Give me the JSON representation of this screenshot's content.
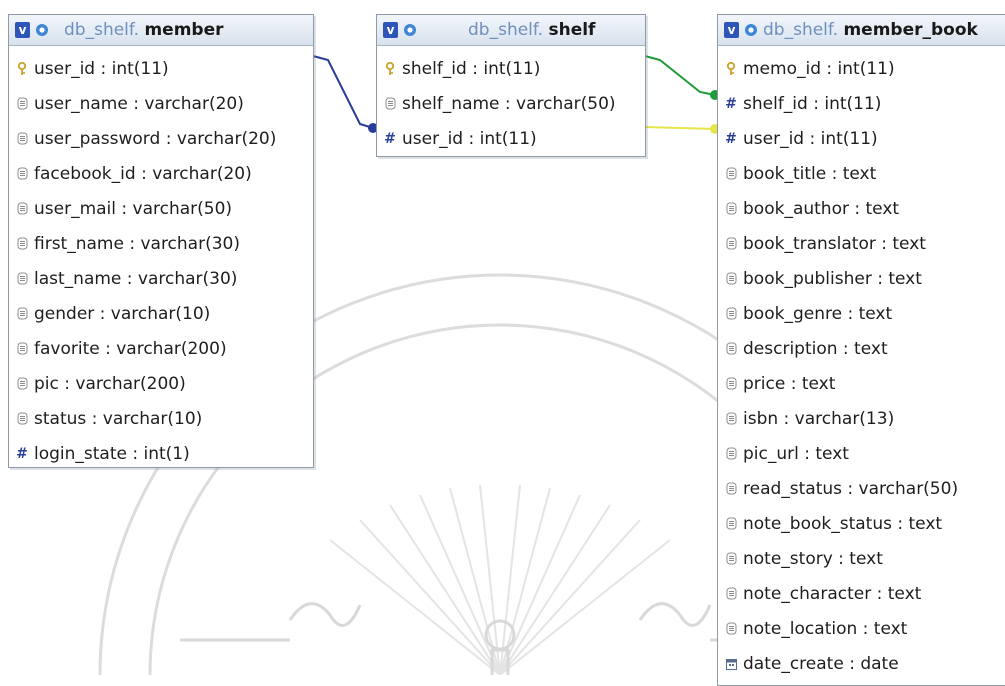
{
  "tables": {
    "member": {
      "schema": "db_shelf.",
      "name": "member",
      "columns": [
        {
          "label": "user_id : int(11)",
          "icon": "primary-key-icon"
        },
        {
          "label": "user_name : varchar(20)",
          "icon": "field-icon"
        },
        {
          "label": "user_password : varchar(20)",
          "icon": "field-icon"
        },
        {
          "label": "facebook_id : varchar(20)",
          "icon": "field-icon"
        },
        {
          "label": "user_mail : varchar(50)",
          "icon": "field-icon"
        },
        {
          "label": "first_name : varchar(30)",
          "icon": "field-icon"
        },
        {
          "label": "last_name : varchar(30)",
          "icon": "field-icon"
        },
        {
          "label": "gender : varchar(10)",
          "icon": "field-icon"
        },
        {
          "label": "favorite : varchar(200)",
          "icon": "field-icon"
        },
        {
          "label": "pic : varchar(200)",
          "icon": "field-icon"
        },
        {
          "label": "status : varchar(10)",
          "icon": "field-icon"
        },
        {
          "label": "login_state : int(1)",
          "icon": "numeric-field-icon"
        }
      ]
    },
    "shelf": {
      "schema": "db_shelf.",
      "name": "shelf",
      "columns": [
        {
          "label": "shelf_id : int(11)",
          "icon": "primary-key-icon"
        },
        {
          "label": "shelf_name : varchar(50)",
          "icon": "field-icon"
        },
        {
          "label": "user_id : int(11)",
          "icon": "numeric-field-icon"
        }
      ]
    },
    "member_book": {
      "schema": "db_shelf.",
      "name": "member_book",
      "columns": [
        {
          "label": "memo_id : int(11)",
          "icon": "primary-key-icon"
        },
        {
          "label": "shelf_id : int(11)",
          "icon": "numeric-field-icon"
        },
        {
          "label": "user_id : int(11)",
          "icon": "numeric-field-icon"
        },
        {
          "label": "book_title : text",
          "icon": "field-icon"
        },
        {
          "label": "book_author : text",
          "icon": "field-icon"
        },
        {
          "label": "book_translator : text",
          "icon": "field-icon"
        },
        {
          "label": "book_publisher : text",
          "icon": "field-icon"
        },
        {
          "label": "book_genre : text",
          "icon": "field-icon"
        },
        {
          "label": "description : text",
          "icon": "field-icon"
        },
        {
          "label": "price : text",
          "icon": "field-icon"
        },
        {
          "label": "isbn : varchar(13)",
          "icon": "field-icon"
        },
        {
          "label": "pic_url : text",
          "icon": "field-icon"
        },
        {
          "label": "read_status : varchar(50)",
          "icon": "field-icon"
        },
        {
          "label": "note_book_status : text",
          "icon": "field-icon"
        },
        {
          "label": "note_story : text",
          "icon": "field-icon"
        },
        {
          "label": "note_character : text",
          "icon": "field-icon"
        },
        {
          "label": "note_location : text",
          "icon": "field-icon"
        },
        {
          "label": "date_create : date",
          "icon": "date-field-icon"
        }
      ]
    }
  },
  "relations": [
    {
      "from": "member.user_id",
      "to": "shelf.user_id",
      "color": "#2a3d9a"
    },
    {
      "from": "shelf.shelf_id",
      "to": "member_book.shelf_id",
      "color": "#1f9a3a"
    },
    {
      "from": "shelf.user_id",
      "to": "member_book.user_id",
      "color": "#e6e64a"
    }
  ],
  "colors": {
    "header_schema": "#6f8fbf",
    "key_icon": "#c9a227",
    "hash_icon": "#2b3f99"
  }
}
